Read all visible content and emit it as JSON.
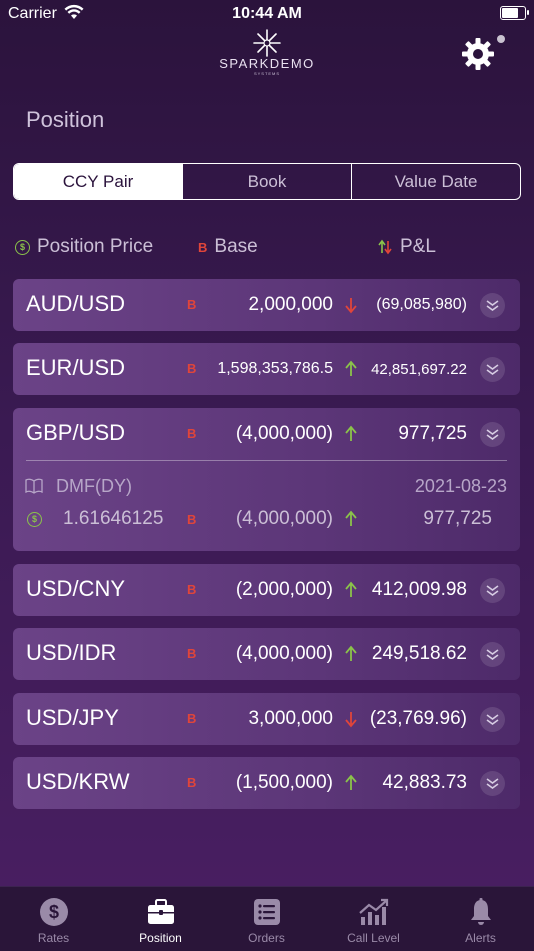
{
  "status_bar": {
    "carrier": "Carrier",
    "time": "10:44 AM",
    "battery_level": 0.8
  },
  "header": {
    "logo_text": "SPARKDEMO",
    "logo_subtext": "SYSTEMS"
  },
  "page": {
    "title": "Position"
  },
  "segments": [
    {
      "label": "CCY Pair",
      "active": true
    },
    {
      "label": "Book",
      "active": false
    },
    {
      "label": "Value Date",
      "active": false
    }
  ],
  "legend": {
    "price_label": "Position Price",
    "base_label": "Base",
    "pnl_label": "P&L",
    "dollar_symbol": "$",
    "b_symbol": "B"
  },
  "positions": [
    {
      "pair": "AUD/USD",
      "book": "B",
      "amount": "2,000,000",
      "direction": "down",
      "pnl": "(69,085,980)"
    },
    {
      "pair": "EUR/USD",
      "book": "B",
      "amount": "1,598,353,786.5",
      "direction": "up",
      "pnl": "42,851,697.22"
    },
    {
      "pair": "GBP/USD",
      "book": "B",
      "amount": "(4,000,000)",
      "direction": "up",
      "pnl": "977,725",
      "detail": {
        "book_name": "DMF(DY)",
        "value_date": "2021-08-23",
        "price": "1.61646125",
        "book": "B",
        "amount": "(4,000,000)",
        "direction": "up",
        "pnl": "977,725"
      }
    },
    {
      "pair": "USD/CNY",
      "book": "B",
      "amount": "(2,000,000)",
      "direction": "up",
      "pnl": "412,009.98"
    },
    {
      "pair": "USD/IDR",
      "book": "B",
      "amount": "(4,000,000)",
      "direction": "up",
      "pnl": "249,518.62"
    },
    {
      "pair": "USD/JPY",
      "book": "B",
      "amount": "3,000,000",
      "direction": "down",
      "pnl": "(23,769.96)"
    },
    {
      "pair": "USD/KRW",
      "book": "",
      "amount": "(1,500,000)",
      "direction": "up",
      "pnl": "42,883.73"
    }
  ],
  "colors": {
    "up": "#8bc34a",
    "down": "#e0453a",
    "accent": "#ffffff"
  },
  "tabbar": [
    {
      "label": "Rates",
      "icon": "dollar-circle-icon",
      "active": false
    },
    {
      "label": "Position",
      "icon": "briefcase-icon",
      "active": true
    },
    {
      "label": "Orders",
      "icon": "list-icon",
      "active": false
    },
    {
      "label": "Call Level",
      "icon": "chart-up-icon",
      "active": false
    },
    {
      "label": "Alerts",
      "icon": "bell-icon",
      "active": false
    }
  ]
}
